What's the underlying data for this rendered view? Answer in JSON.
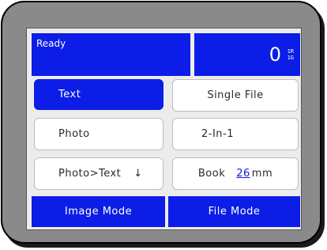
{
  "status": {
    "text": "Ready"
  },
  "counter": {
    "value": "0",
    "sub_top": "1R",
    "sub_bottom": "1G"
  },
  "image_options": [
    {
      "label": "Text",
      "selected": true
    },
    {
      "label": "Photo",
      "selected": false
    },
    {
      "label": "Photo>Text",
      "selected": false
    }
  ],
  "file_options": [
    {
      "label": "Single File"
    },
    {
      "label": "2-In-1"
    },
    {
      "label": "Book",
      "value": "26",
      "unit": "mm"
    }
  ],
  "arrow_icon": "down-arrow-icon",
  "bottom_bar": {
    "image_mode_label": "Image Mode",
    "file_mode_label": "File Mode"
  },
  "colors": {
    "accent": "#0b1de6",
    "frame": "#8a8a8a",
    "screen": "#ececec"
  }
}
